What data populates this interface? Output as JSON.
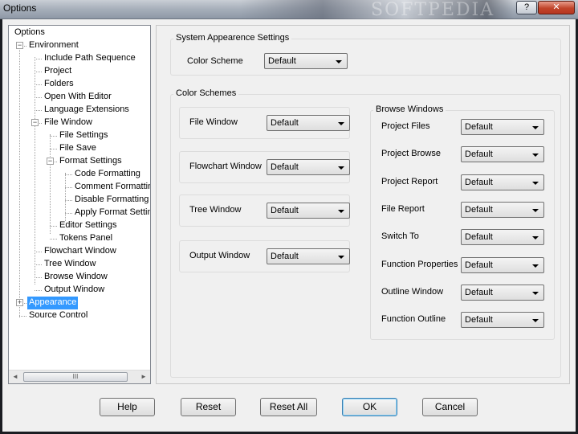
{
  "window": {
    "title": "Options",
    "watermark": "SOFTPEDIA",
    "help_glyph": "?",
    "close_glyph": "✕"
  },
  "tree": {
    "items": [
      {
        "label": "Options"
      },
      {
        "label": "Environment",
        "expander": "−"
      },
      {
        "label": "Include Path Sequence"
      },
      {
        "label": "Project"
      },
      {
        "label": "Folders"
      },
      {
        "label": "Open With Editor"
      },
      {
        "label": "Language Extensions"
      },
      {
        "label": "File Window",
        "expander": "−"
      },
      {
        "label": "File Settings"
      },
      {
        "label": "File Save"
      },
      {
        "label": "Format Settings",
        "expander": "−"
      },
      {
        "label": "Code Formatting"
      },
      {
        "label": "Comment Formatting"
      },
      {
        "label": "Disable Formatting"
      },
      {
        "label": "Apply Format Settings"
      },
      {
        "label": "Editor Settings"
      },
      {
        "label": "Tokens Panel"
      },
      {
        "label": "Flowchart Window"
      },
      {
        "label": "Tree Window"
      },
      {
        "label": "Browse Window"
      },
      {
        "label": "Output Window"
      },
      {
        "label": "Appearance",
        "expander": "+",
        "selected": true
      },
      {
        "label": "Source Control"
      }
    ],
    "scroll_left": "◄",
    "scroll_right": "►",
    "scroll_grip": "III"
  },
  "system": {
    "title": "System Appearence Settings",
    "color_scheme_label": "Color Scheme",
    "color_scheme_value": "Default"
  },
  "schemes": {
    "title": "Color Schemes",
    "left": [
      {
        "label": "File Window",
        "value": "Default"
      },
      {
        "label": "Flowchart Window",
        "value": "Default"
      },
      {
        "label": "Tree Window",
        "value": "Default"
      },
      {
        "label": "Output Window",
        "value": "Default"
      }
    ],
    "browse": {
      "title": "Browse Windows",
      "items": [
        {
          "label": "Project Files",
          "value": "Default"
        },
        {
          "label": "Project Browse",
          "value": "Default"
        },
        {
          "label": "Project Report",
          "value": "Default"
        },
        {
          "label": "File Report",
          "value": "Default"
        },
        {
          "label": "Switch To",
          "value": "Default"
        },
        {
          "label": "Function Properties",
          "value": "Default"
        },
        {
          "label": "Outline Window",
          "value": "Default"
        },
        {
          "label": "Function Outline",
          "value": "Default"
        }
      ]
    }
  },
  "buttons": {
    "help": "Help",
    "reset": "Reset",
    "reset_all": "Reset All",
    "ok": "OK",
    "cancel": "Cancel"
  }
}
